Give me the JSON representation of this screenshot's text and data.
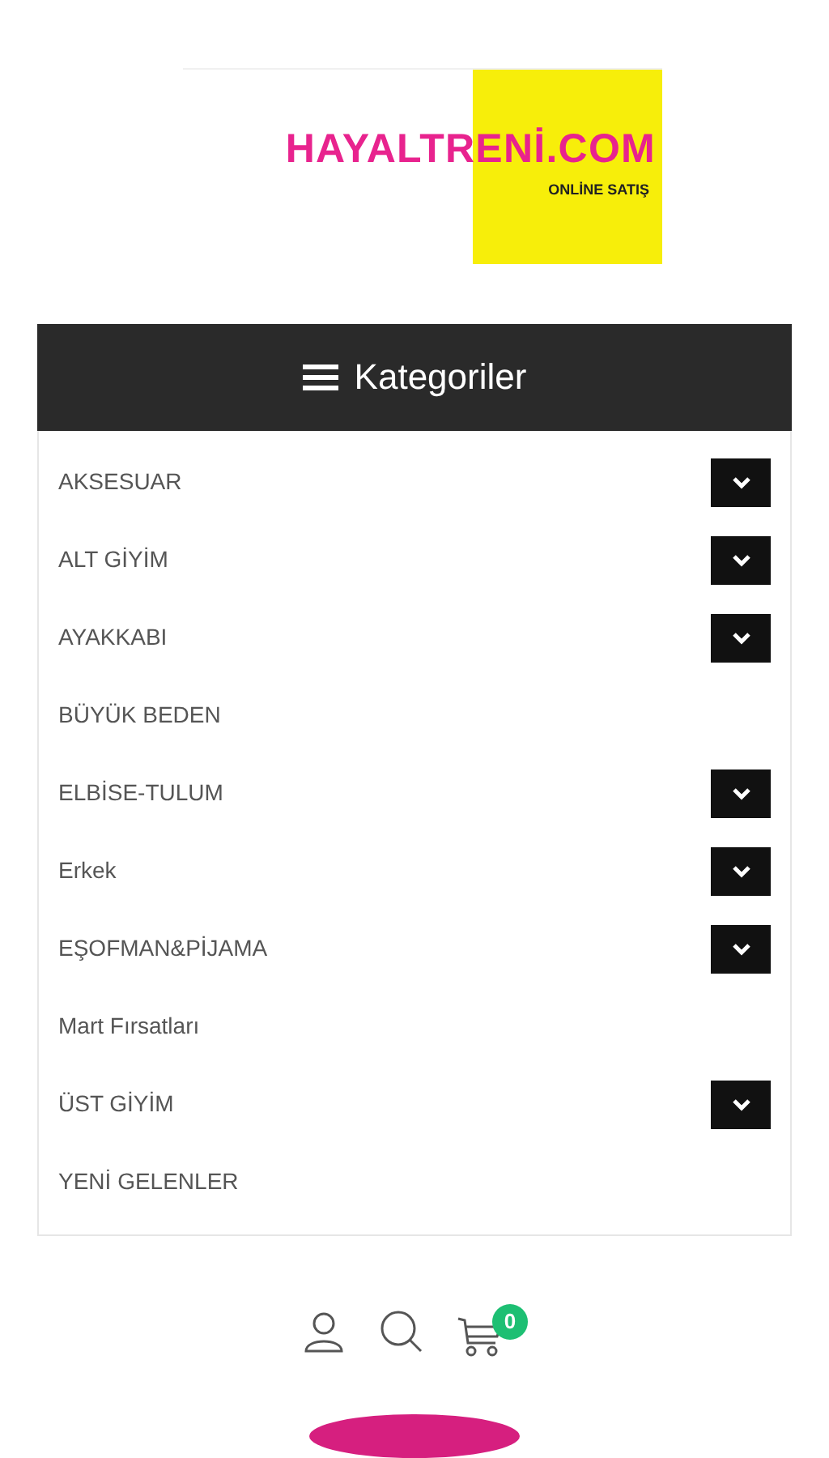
{
  "logo": {
    "title": "HAYALTRENİ.COM",
    "subtitle": "ONLİNE SATIŞ"
  },
  "categories": {
    "title": "Kategoriler",
    "items": [
      {
        "label": "AKSESUAR",
        "expandable": true
      },
      {
        "label": "ALT GİYİM",
        "expandable": true
      },
      {
        "label": "AYAKKABI",
        "expandable": true
      },
      {
        "label": "BÜYÜK BEDEN",
        "expandable": false
      },
      {
        "label": "ELBİSE-TULUM",
        "expandable": true
      },
      {
        "label": "Erkek",
        "expandable": true
      },
      {
        "label": "EŞOFMAN&PİJAMA",
        "expandable": true
      },
      {
        "label": "Mart Fırsatları",
        "expandable": false
      },
      {
        "label": "ÜST GİYİM",
        "expandable": true
      },
      {
        "label": "YENİ GELENLER",
        "expandable": false
      }
    ]
  },
  "cart": {
    "count": "0"
  }
}
